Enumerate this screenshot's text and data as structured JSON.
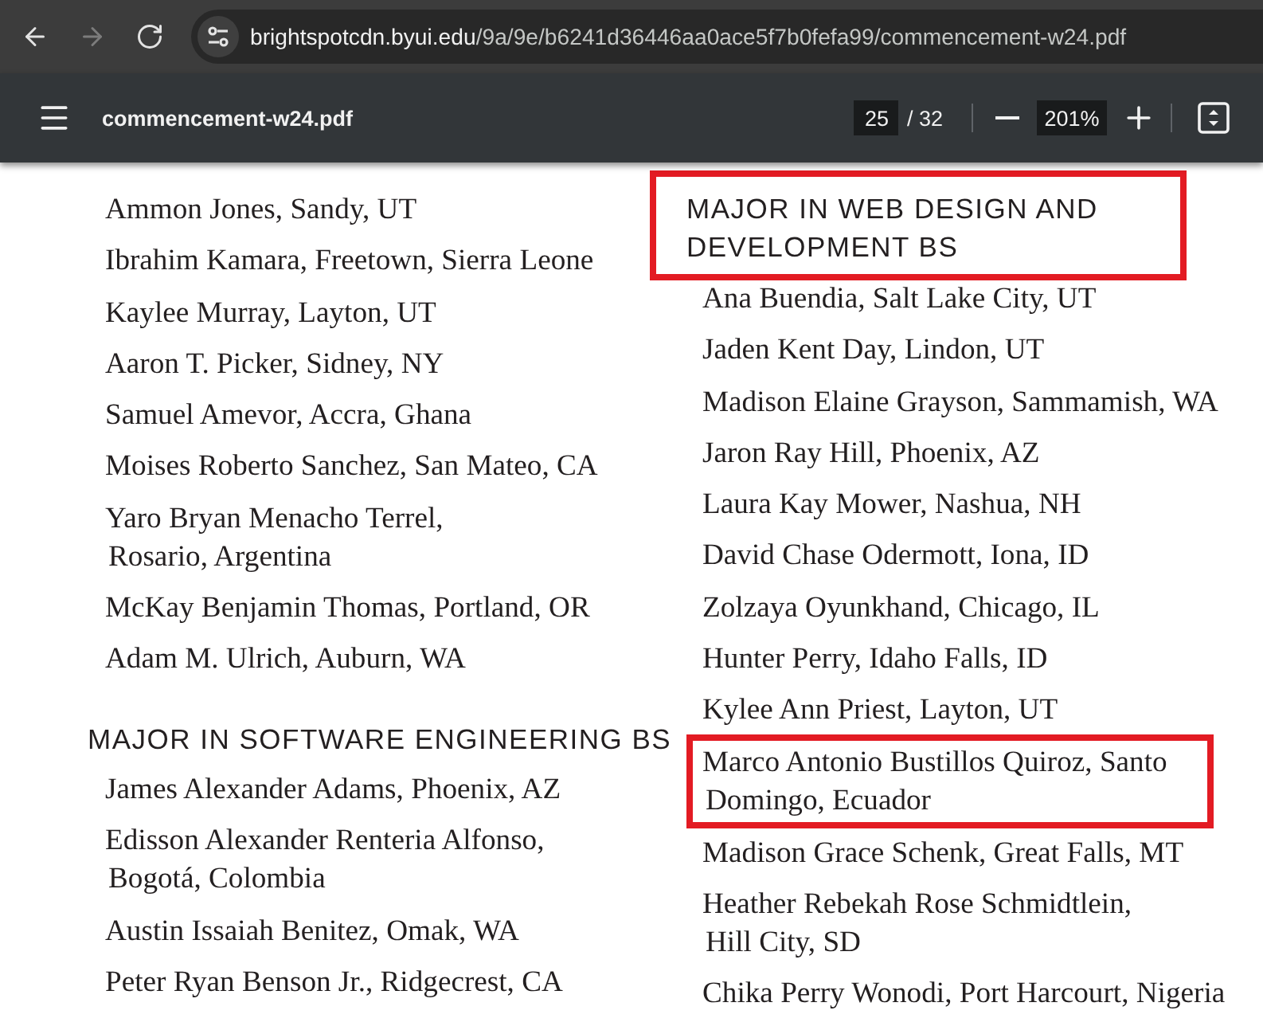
{
  "browser": {
    "nav_buttons": [
      {
        "kind": "back",
        "disabled": false
      },
      {
        "kind": "forward",
        "disabled": true
      },
      {
        "kind": "reload",
        "disabled": false
      }
    ],
    "address_bar": {
      "host": "brightspotcdn.byui.edu",
      "path": "/9a/9e/b6241d36446aa0ace5f7b0fefa99/commencement-w24.pdf"
    }
  },
  "pdf_toolbar": {
    "title": "commencement-w24.pdf",
    "page": "25",
    "page_count": "/ 32",
    "zoom": "201%"
  },
  "document": {
    "columns": [
      {
        "sections": [
          {
            "entries": [
              {
                "lines": [
                  "Ammon Jones, Sandy, UT"
                ],
                "highlighted": false
              },
              {
                "lines": [
                  "Ibrahim Kamara, Freetown, Sierra Leone"
                ],
                "highlighted": false
              },
              {
                "lines": [
                  "Kaylee Murray, Layton, UT"
                ],
                "highlighted": false
              },
              {
                "lines": [
                  "Aaron T. Picker, Sidney, NY"
                ],
                "highlighted": false
              },
              {
                "lines": [
                  "Samuel Amevor, Accra, Ghana"
                ],
                "highlighted": false
              },
              {
                "lines": [
                  "Moises Roberto Sanchez, San Mateo, CA"
                ],
                "highlighted": false
              },
              {
                "lines": [
                  "Yaro Bryan Menacho Terrel,",
                  "Rosario, Argentina"
                ],
                "highlighted": false
              },
              {
                "lines": [
                  "McKay Benjamin Thomas, Portland, OR"
                ],
                "highlighted": false
              },
              {
                "lines": [
                  "Adam M. Ulrich, Auburn, WA"
                ],
                "highlighted": false
              }
            ]
          },
          {
            "heading": {
              "lines": [
                "MAJOR IN SOFTWARE ENGINEERING BS"
              ],
              "highlighted": false
            },
            "entries": [
              {
                "lines": [
                  "James Alexander Adams, Phoenix, AZ"
                ],
                "highlighted": false
              },
              {
                "lines": [
                  "Edisson Alexander Renteria Alfonso,",
                  "Bogotá, Colombia"
                ],
                "highlighted": false
              },
              {
                "lines": [
                  "Austin Issaiah Benitez, Omak, WA"
                ],
                "highlighted": false
              },
              {
                "lines": [
                  "Peter Ryan Benson Jr., Ridgecrest, CA"
                ],
                "highlighted": false
              }
            ]
          }
        ]
      },
      {
        "sections": [
          {
            "heading": {
              "lines": [
                "MAJOR IN WEB DESIGN AND",
                "DEVELOPMENT BS"
              ],
              "highlighted": true
            },
            "entries": [
              {
                "lines": [
                  "Ana Buendia, Salt Lake City, UT"
                ],
                "highlighted": false
              },
              {
                "lines": [
                  "Jaden Kent Day, Lindon, UT"
                ],
                "highlighted": false
              },
              {
                "lines": [
                  "Madison Elaine Grayson, Sammamish, WA"
                ],
                "highlighted": false
              },
              {
                "lines": [
                  "Jaron Ray Hill, Phoenix, AZ"
                ],
                "highlighted": false
              },
              {
                "lines": [
                  "Laura Kay Mower, Nashua, NH"
                ],
                "highlighted": false
              },
              {
                "lines": [
                  "David Chase Odermott, Iona, ID"
                ],
                "highlighted": false
              },
              {
                "lines": [
                  "Zolzaya Oyunkhand, Chicago, IL"
                ],
                "highlighted": false
              },
              {
                "lines": [
                  "Hunter Perry, Idaho Falls, ID"
                ],
                "highlighted": false
              },
              {
                "lines": [
                  "Kylee Ann Priest, Layton, UT"
                ],
                "highlighted": false
              },
              {
                "lines": [
                  "Marco Antonio Bustillos Quiroz, Santo",
                  "Domingo, Ecuador"
                ],
                "highlighted": true
              },
              {
                "lines": [
                  "Madison Grace Schenk, Great Falls, MT"
                ],
                "highlighted": false
              },
              {
                "lines": [
                  "Heather Rebekah Rose Schmidtlein,",
                  "Hill City, SD"
                ],
                "highlighted": false
              },
              {
                "lines": [
                  "Chika Perry Wonodi, Port Harcourt, Nigeria"
                ],
                "highlighted": false
              }
            ]
          }
        ]
      }
    ]
  }
}
